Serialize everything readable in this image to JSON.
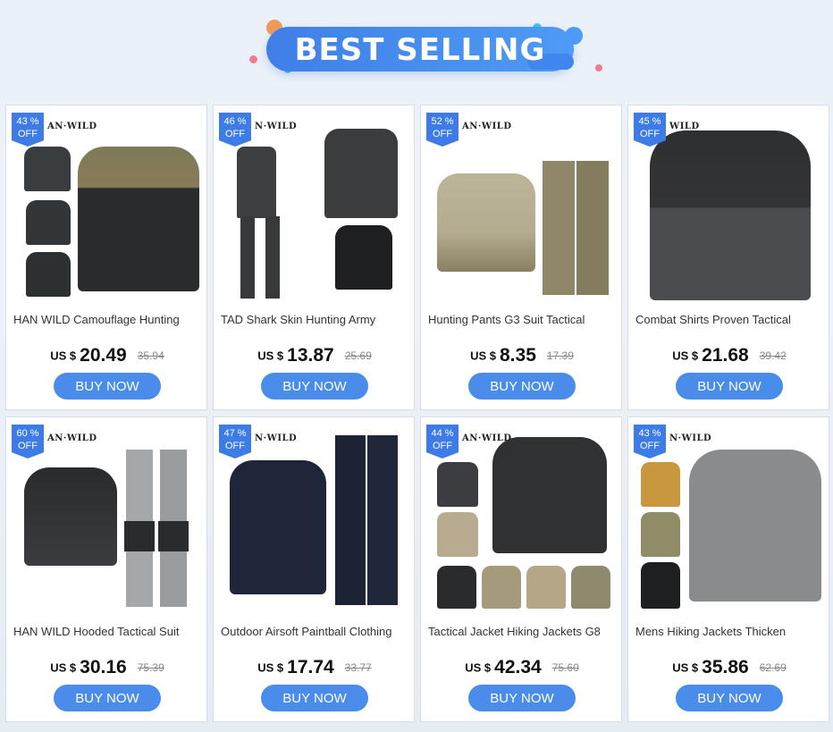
{
  "banner": {
    "title": "BEST SELLING"
  },
  "colors": {
    "accent": "#3d7be6",
    "button": "#4a8ce9",
    "banner": "#3f7fe8",
    "dot_orange": "#f39a5a",
    "dot_pink": "#f07c8e",
    "dot_cyan": "#3fc6ea"
  },
  "products": [
    {
      "badge_pct": "43 %",
      "badge_off": "OFF",
      "brand": "AN·WILD",
      "title": "HAN WILD Camouflage Hunting",
      "currency": "US $",
      "price": "20.49",
      "old_price": "35.94",
      "button": "BUY NOW"
    },
    {
      "badge_pct": "46 %",
      "badge_off": "OFF",
      "brand": "N·WILD",
      "title": "TAD Shark Skin Hunting Army",
      "currency": "US $",
      "price": "13.87",
      "old_price": "25.69",
      "button": "BUY NOW"
    },
    {
      "badge_pct": "52 %",
      "badge_off": "OFF",
      "brand": "AN·WILD",
      "title": "Hunting Pants G3 Suit Tactical",
      "currency": "US $",
      "price": "8.35",
      "old_price": "17.39",
      "button": "BUY NOW"
    },
    {
      "badge_pct": "45 %",
      "badge_off": "OFF",
      "brand": "WILD",
      "title": "Combat Shirts Proven Tactical",
      "currency": "US $",
      "price": "21.68",
      "old_price": "39.42",
      "button": "BUY NOW"
    },
    {
      "badge_pct": "60 %",
      "badge_off": "OFF",
      "brand": "AN·WILD",
      "title": "HAN WILD Hooded Tactical Suit",
      "currency": "US $",
      "price": "30.16",
      "old_price": "75.39",
      "button": "BUY NOW"
    },
    {
      "badge_pct": "47 %",
      "badge_off": "OFF",
      "brand": "N·WILD",
      "title": "Outdoor Airsoft Paintball Clothing",
      "currency": "US $",
      "price": "17.74",
      "old_price": "33.77",
      "button": "BUY NOW"
    },
    {
      "badge_pct": "44 %",
      "badge_off": "OFF",
      "brand": "AN·WILD",
      "title": "Tactical Jacket Hiking Jackets G8",
      "currency": "US $",
      "price": "42.34",
      "old_price": "75.60",
      "button": "BUY NOW"
    },
    {
      "badge_pct": "43 %",
      "badge_off": "OFF",
      "brand": "N·WILD",
      "title": "Mens Hiking Jackets Thicken",
      "currency": "US $",
      "price": "35.86",
      "old_price": "62.69",
      "button": "BUY NOW"
    }
  ]
}
